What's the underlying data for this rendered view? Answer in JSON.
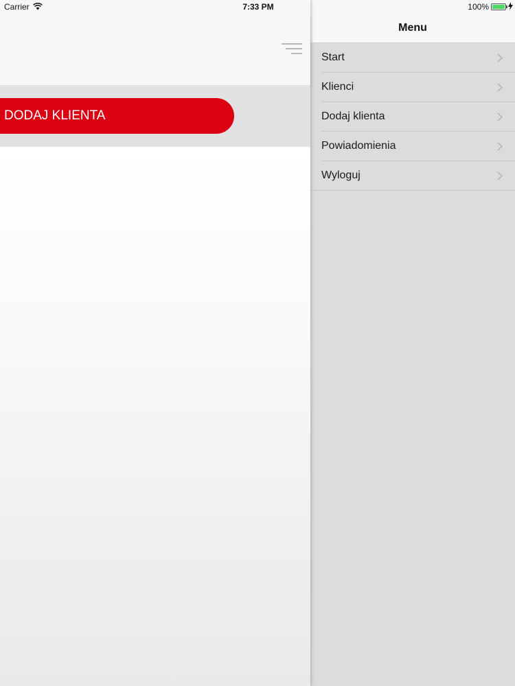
{
  "status_bar": {
    "carrier": "Carrier",
    "time": "7:33 PM",
    "battery": "100%"
  },
  "main": {
    "add_client_button": "DODAJ KLIENTA",
    "accent_color": "#dc0013"
  },
  "menu": {
    "title": "Menu",
    "items": [
      {
        "label": "Start"
      },
      {
        "label": "Klienci"
      },
      {
        "label": "Dodaj klienta"
      },
      {
        "label": "Powiadomienia"
      },
      {
        "label": "Wyloguj"
      }
    ]
  },
  "icons": [
    "wifi-icon",
    "hamburger-menu-icon",
    "battery-icon",
    "charging-bolt-icon",
    "chevron-right-icon"
  ]
}
